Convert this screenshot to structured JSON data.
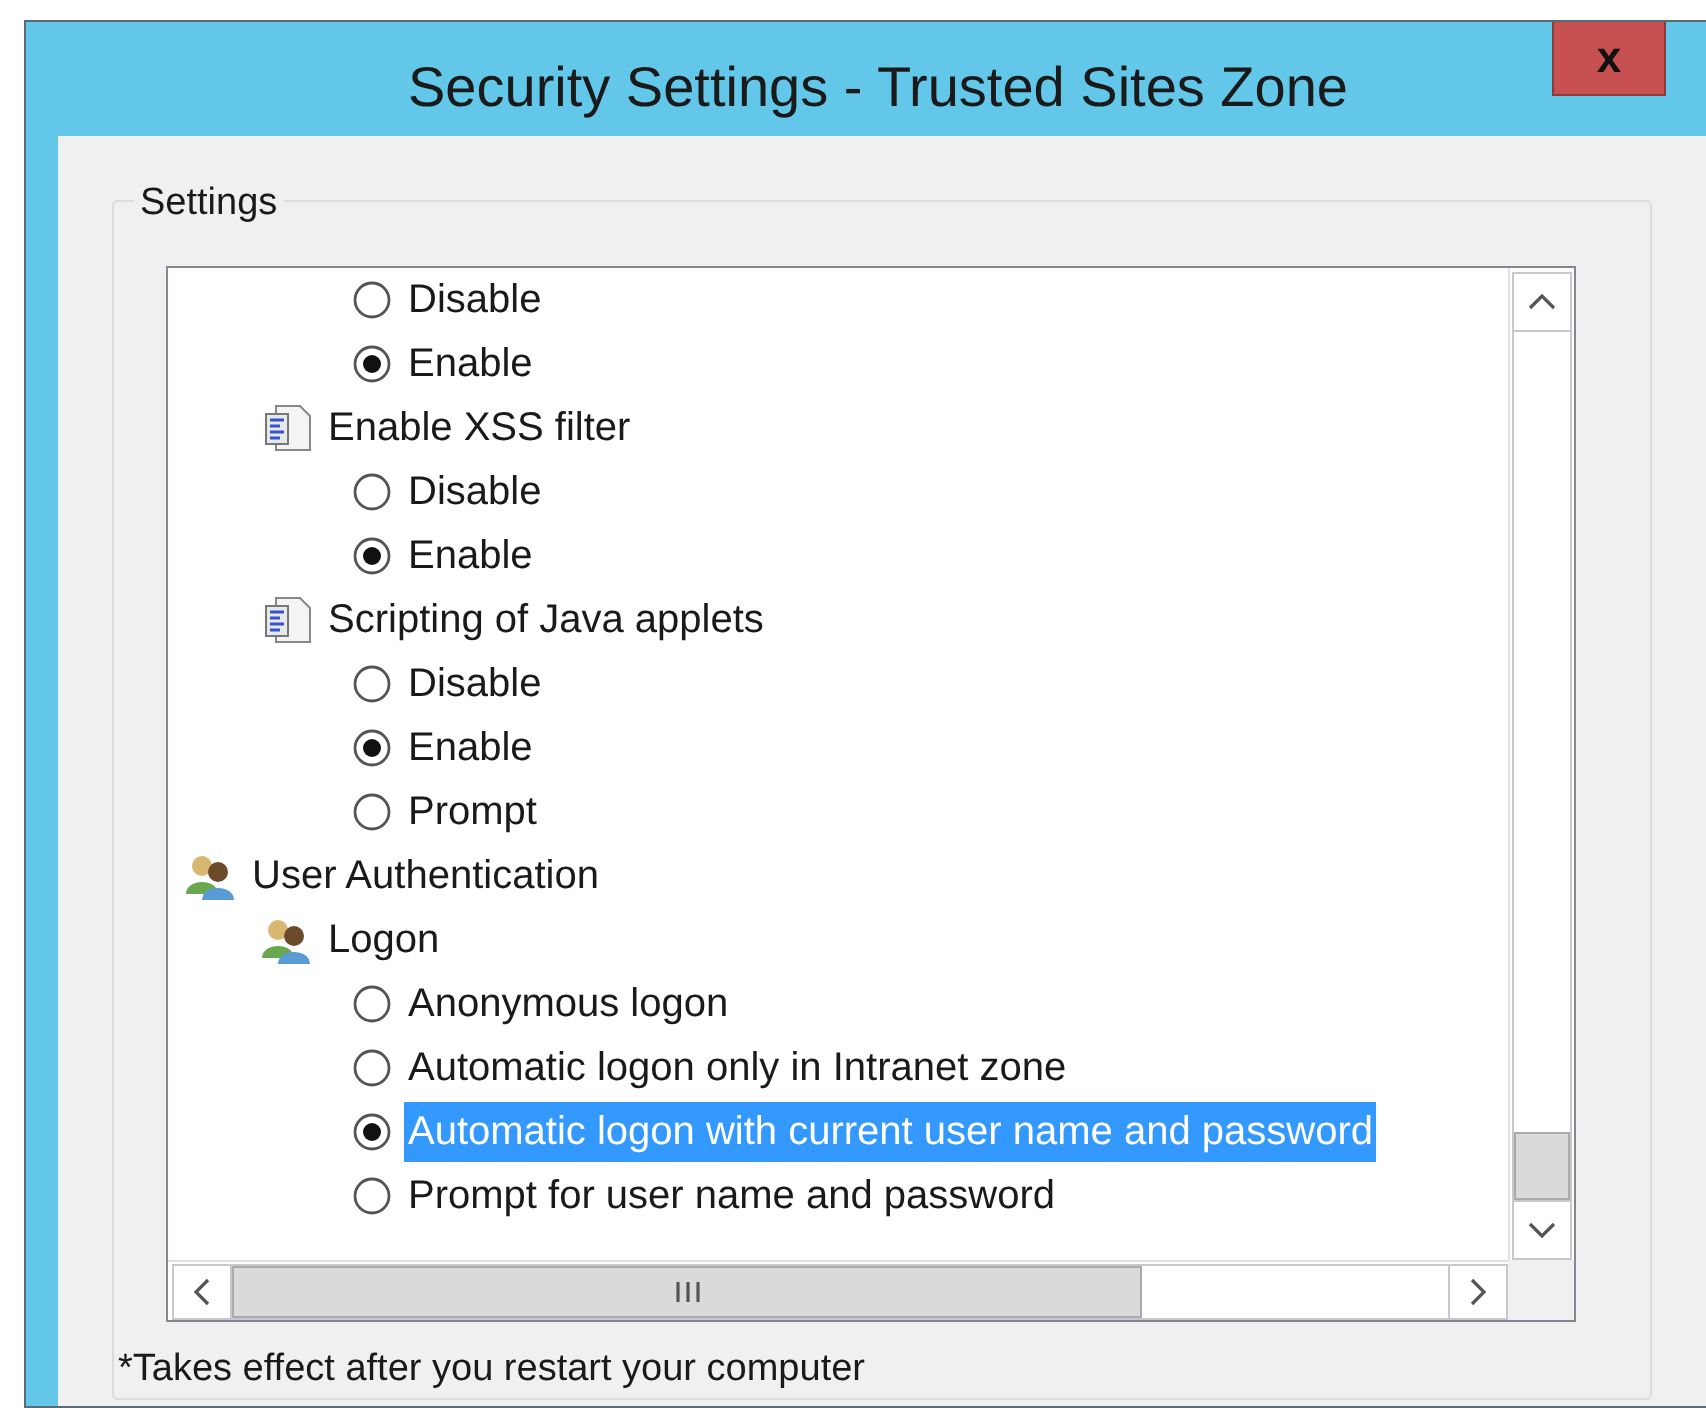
{
  "window": {
    "title": "Security Settings - Trusted Sites Zone",
    "close_label": "x"
  },
  "settings_group": {
    "label": "Settings"
  },
  "tree": [
    {
      "kind": "continued",
      "children": [
        {
          "kind": "continued",
          "children": [
            {
              "kind": "option",
              "label": "Disable",
              "selected": false,
              "focused": false
            },
            {
              "kind": "option",
              "label": "Enable",
              "selected": true,
              "focused": false
            }
          ]
        },
        {
          "kind": "script",
          "label": "Enable XSS filter",
          "children": [
            {
              "kind": "option",
              "label": "Disable",
              "selected": false,
              "focused": false
            },
            {
              "kind": "option",
              "label": "Enable",
              "selected": true,
              "focused": false
            }
          ]
        },
        {
          "kind": "script",
          "label": "Scripting of Java applets",
          "children": [
            {
              "kind": "option",
              "label": "Disable",
              "selected": false,
              "focused": false
            },
            {
              "kind": "option",
              "label": "Enable",
              "selected": true,
              "focused": false
            },
            {
              "kind": "option",
              "label": "Prompt",
              "selected": false,
              "focused": false
            }
          ]
        }
      ]
    },
    {
      "kind": "users",
      "label": "User Authentication",
      "children": [
        {
          "kind": "users",
          "label": "Logon",
          "children": [
            {
              "kind": "option",
              "label": "Anonymous logon",
              "selected": false,
              "focused": false
            },
            {
              "kind": "option",
              "label": "Automatic logon only in Intranet zone",
              "selected": false,
              "focused": false
            },
            {
              "kind": "option",
              "label": "Automatic logon with current user name and password",
              "selected": true,
              "focused": true
            },
            {
              "kind": "option",
              "label": "Prompt for user name and password",
              "selected": false,
              "focused": false
            }
          ]
        }
      ]
    }
  ],
  "footnote": "*Takes effect after you restart your computer"
}
